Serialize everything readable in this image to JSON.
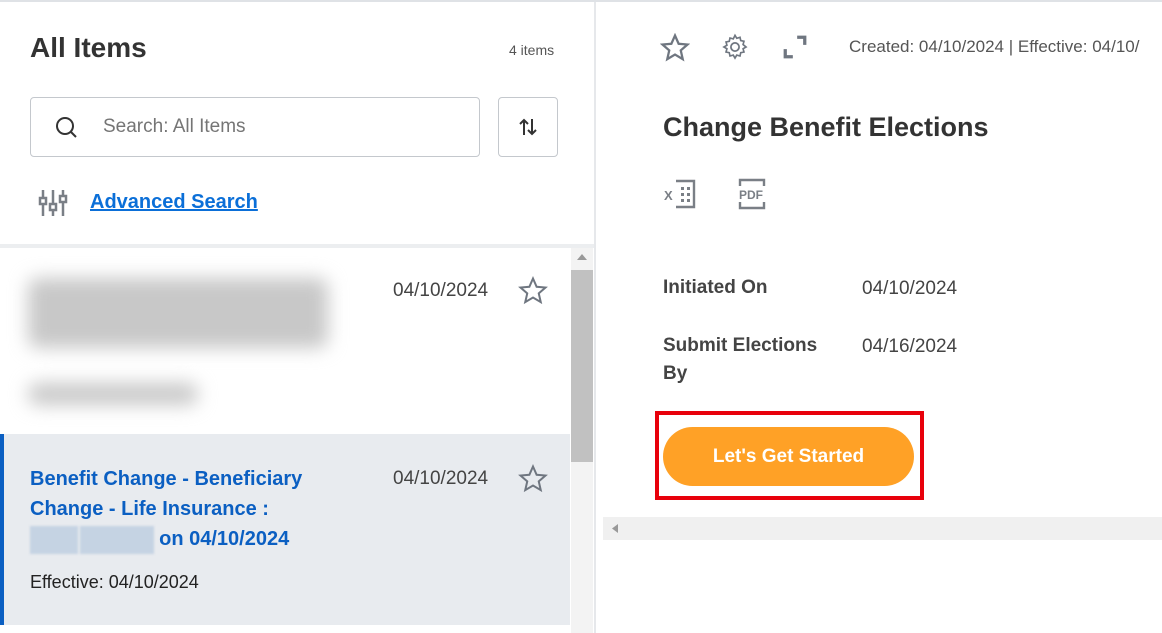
{
  "left": {
    "title": "All Items",
    "count": "4 items",
    "search_placeholder": "Search: All Items",
    "advanced_search": "Advanced Search",
    "items": [
      {
        "date": "04/10/2024"
      },
      {
        "title_part1": "Benefit Change - Beneficiary Change - Life Insurance :",
        "title_part2": "on 04/10/2024",
        "date": "04/10/2024",
        "effective": "Effective: 04/10/2024"
      }
    ]
  },
  "right": {
    "meta": "Created: 04/10/2024 | Effective: 04/10/",
    "title": "Change Benefit Elections",
    "fields": [
      {
        "label": "Initiated On",
        "value": "04/10/2024"
      },
      {
        "label": "Submit Elections By",
        "value": "04/16/2024"
      }
    ],
    "button": "Let's Get Started"
  },
  "colors": {
    "accent": "#0b5fc2",
    "button": "#ffa126",
    "highlight": "#e8000b"
  }
}
